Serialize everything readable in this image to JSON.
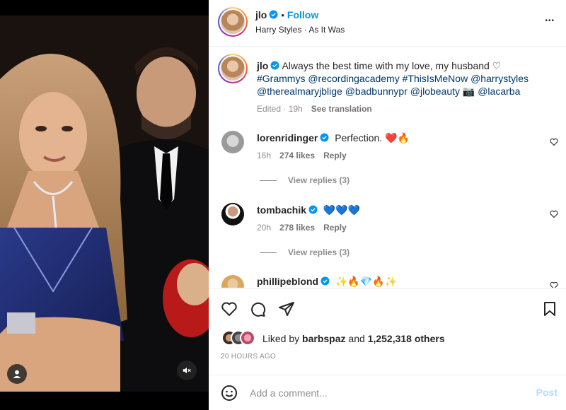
{
  "post": {
    "username": "jlo",
    "follow_label": "Follow",
    "audio": "Harry Styles · As It Was",
    "more_label": "•••"
  },
  "caption": {
    "username": "jlo",
    "text": "Always the best time with my love, my husband ♡",
    "tags_line1": "#Grammys @recordingacademy #ThisIsMeNow @harrystyles",
    "tags_line2": "@therealmaryjblige @badbunnypr @jlobeauty 📷 @lacarba",
    "edited": "Edited · 19h",
    "translate": "See translation"
  },
  "comments": [
    {
      "username": "lorenridinger",
      "text": "Perfection. ❤️🔥",
      "age": "16h",
      "likes": "274 likes",
      "reply": "Reply",
      "replies": "View replies (3)"
    },
    {
      "username": "tombachik",
      "text": "💙💙💙",
      "age": "20h",
      "likes": "278 likes",
      "reply": "Reply",
      "replies": "View replies (3)"
    },
    {
      "username": "phillipeblond",
      "text": "✨🔥💎🔥✨"
    }
  ],
  "likes": {
    "prefix": "Liked by",
    "user": "barbspaz",
    "middle": "and",
    "count": "1,252,318 others"
  },
  "timestamp": "20 HOURS AGO",
  "composer": {
    "placeholder": "Add a comment...",
    "post_label": "Post"
  },
  "colors": {
    "accent": "#0095f6",
    "verified": "#0095f6",
    "hashtag": "#00376b",
    "post_disabled": "#b3dbff"
  }
}
